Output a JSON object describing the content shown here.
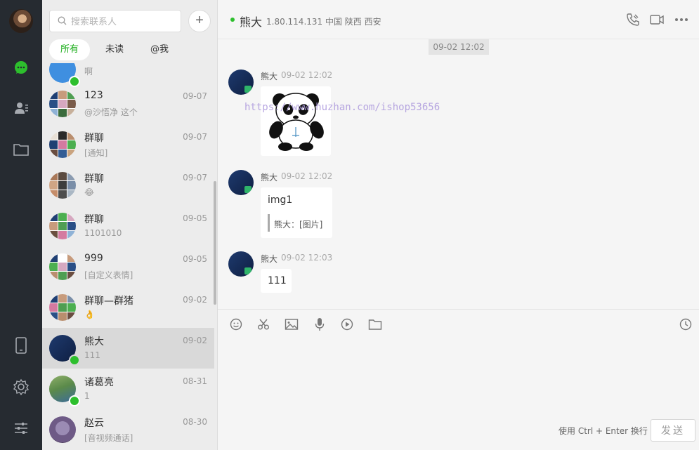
{
  "search": {
    "placeholder": "搜索联系人",
    "add_label": "+"
  },
  "tabs": [
    {
      "label": "所有",
      "active": true
    },
    {
      "label": "未读",
      "active": false
    },
    {
      "label": "@我",
      "active": false
    }
  ],
  "conversations": [
    {
      "name": "",
      "date": "",
      "preview": "啊",
      "online": true
    },
    {
      "name": "123",
      "date": "09-07",
      "preview": "@沙悟净 这个",
      "online": false
    },
    {
      "name": "群聊",
      "date": "09-07",
      "preview": "[通知]",
      "online": false
    },
    {
      "name": "群聊",
      "date": "09-07",
      "preview": "😂",
      "online": false
    },
    {
      "name": "群聊",
      "date": "09-05",
      "preview": "1101010",
      "online": false
    },
    {
      "name": "999",
      "date": "09-05",
      "preview": "[自定义表情]",
      "online": false
    },
    {
      "name": "群聊—群猪",
      "date": "09-02",
      "preview": "👌",
      "online": false
    },
    {
      "name": "熊大",
      "date": "09-02",
      "preview": "111",
      "online": true,
      "active": true
    },
    {
      "name": "诸葛亮",
      "date": "08-31",
      "preview": "1",
      "online": true
    },
    {
      "name": "赵云",
      "date": "08-30",
      "preview": "[音视频通话]",
      "online": false
    }
  ],
  "chat": {
    "title": "熊大",
    "meta": "1.80.114.131 中国 陕西 西安",
    "time_chip": "09-02 12:02",
    "watermark": "https://www.huzhan.com/ishop53656",
    "messages": [
      {
        "sender": "熊大",
        "time": "09-02 12:02",
        "type": "image"
      },
      {
        "sender": "熊大",
        "time": "09-02 12:02",
        "type": "quote",
        "text": "img1",
        "quote": "熊大：[图片]"
      },
      {
        "sender": "熊大",
        "time": "09-02 12:03",
        "type": "text",
        "text": "111"
      }
    ]
  },
  "input": {
    "hint": "使用 Ctrl + Enter 换行",
    "send_label": "发送"
  },
  "colors": {
    "accent": "#1aad19",
    "online": "#2dbf2d",
    "rail": "#262b31"
  }
}
